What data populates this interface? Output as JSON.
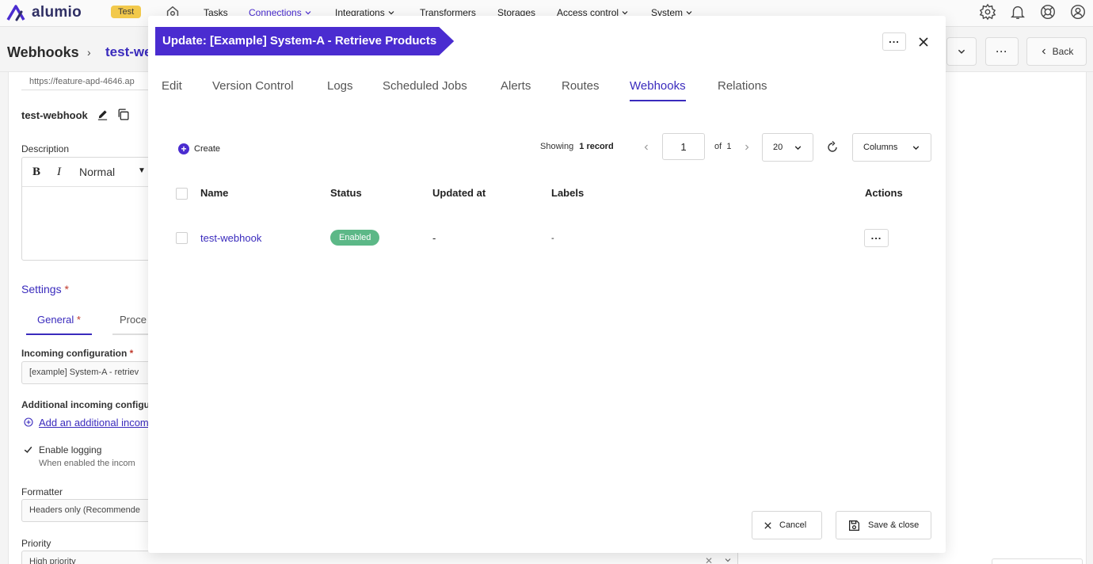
{
  "topnav": {
    "logo_text": "alumio",
    "env_badge": "Test",
    "items": [
      {
        "label": "Tasks"
      },
      {
        "label": "Connections"
      },
      {
        "label": "Integrations"
      },
      {
        "label": "Transformers"
      },
      {
        "label": "Storages"
      },
      {
        "label": "Access control"
      },
      {
        "label": "System"
      }
    ],
    "active_color": "#4a2cd0"
  },
  "background": {
    "title": "Webhooks",
    "crumb": "test-we",
    "back_label": "Back",
    "url": "https://feature-apd-4646.ap",
    "webhook_name": "test-webhook",
    "description_label": "Description",
    "editor_style": "Normal",
    "settings_label": "Settings",
    "general_tab": "General",
    "proc_tab": "Proce",
    "incoming_label": "Incoming configuration",
    "incoming_value": "[example] System-A - retriev",
    "additional_label": "Additional incoming configu",
    "add_link": "Add an additional incom",
    "logging_label": "Enable logging",
    "logging_help": "When enabled the incom",
    "formatter_label": "Formatter",
    "formatter_value": "Headers only (Recommende",
    "priority_label": "Priority",
    "priority_value": "High priority",
    "required_mark": "*"
  },
  "modal": {
    "title": "Update: [Example] System-A - Retrieve Products",
    "accent": "#4a2cd0",
    "tabs": [
      {
        "label": "Edit"
      },
      {
        "label": "Version Control"
      },
      {
        "label": "Logs"
      },
      {
        "label": "Scheduled Jobs"
      },
      {
        "label": "Alerts"
      },
      {
        "label": "Routes"
      },
      {
        "label": "Webhooks"
      },
      {
        "label": "Relations"
      }
    ],
    "active_tab": "Webhooks",
    "create_label": "Create",
    "pagination": {
      "showing_label": "Showing",
      "record_count": "1 record",
      "page": "1",
      "of_label": "of",
      "total_pages": "1",
      "page_size": "20",
      "columns_label": "Columns"
    },
    "table": {
      "headers": [
        "Name",
        "Status",
        "Updated at",
        "Labels",
        "Actions"
      ],
      "rows": [
        {
          "name": "test-webhook",
          "status": "Enabled",
          "updated_at": "-",
          "labels": "-"
        }
      ]
    },
    "status_color": "#5cb887",
    "cancel_label": "Cancel",
    "save_label": "Save & close"
  }
}
